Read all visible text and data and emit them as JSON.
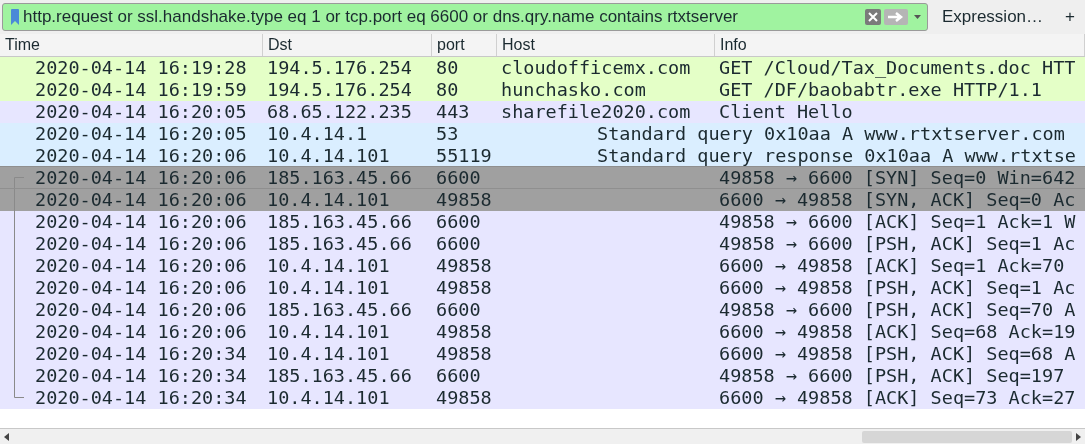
{
  "filter": {
    "value": "http.request or ssl.handshake.type eq 1 or tcp.port eq 6600 or dns.qry.name contains rtxtserver",
    "valid": true,
    "expression_button": "Expression…",
    "add_button": "+"
  },
  "table": {
    "columns": [
      "Time",
      "Dst",
      "port",
      "Host",
      "Info"
    ],
    "rows": [
      {
        "kind": "plain",
        "color": "#e4ffc7",
        "selected": false,
        "time": "2020-04-14 16:19:28",
        "dst": "194.5.176.254",
        "port": "80",
        "host": "cloudofficemx.com",
        "info": "GET /Cloud/Tax_Documents.doc HTT"
      },
      {
        "kind": "plain",
        "color": "#e4ffc7",
        "selected": false,
        "time": "2020-04-14 16:19:59",
        "dst": "194.5.176.254",
        "port": "80",
        "host": "hunchasko.com",
        "info": "GET /DF/baobabtr.exe HTTP/1.1"
      },
      {
        "kind": "plain",
        "color": "#e7e6ff",
        "selected": false,
        "time": "2020-04-14 16:20:05",
        "dst": "68.65.122.235",
        "port": "443",
        "host": "sharefile2020.com",
        "info": "Client Hello"
      },
      {
        "kind": "dns",
        "color": "#daeeff",
        "selected": false,
        "time": "2020-04-14 16:20:05",
        "dst": "10.4.14.1",
        "port": "53",
        "info": "Standard query 0x10aa A www.rtxtserver.com"
      },
      {
        "kind": "dns",
        "color": "#daeeff",
        "selected": false,
        "time": "2020-04-14 16:20:06",
        "dst": "10.4.14.101",
        "port": "55119",
        "info": "Standard query response 0x10aa A www.rtxtse"
      },
      {
        "kind": "conv-first",
        "color": "#a0a0a0",
        "selected": true,
        "time": "2020-04-14 16:20:06",
        "dst": "185.163.45.66",
        "port": "6600",
        "info": "49858 → 6600 [SYN] Seq=0 Win=642"
      },
      {
        "kind": "conv-mid",
        "color": "#a0a0a0",
        "selected": true,
        "time": "2020-04-14 16:20:06",
        "dst": "10.4.14.101",
        "port": "49858",
        "info": "6600 → 49858 [SYN, ACK] Seq=0 Ac"
      },
      {
        "kind": "conv-mid",
        "color": "#e7e6ff",
        "selected": false,
        "time": "2020-04-14 16:20:06",
        "dst": "185.163.45.66",
        "port": "6600",
        "info": "49858 → 6600 [ACK] Seq=1 Ack=1 W"
      },
      {
        "kind": "conv-mid",
        "color": "#e7e6ff",
        "selected": false,
        "time": "2020-04-14 16:20:06",
        "dst": "185.163.45.66",
        "port": "6600",
        "info": "49858 → 6600 [PSH, ACK] Seq=1 Ac"
      },
      {
        "kind": "conv-mid",
        "color": "#e7e6ff",
        "selected": false,
        "time": "2020-04-14 16:20:06",
        "dst": "10.4.14.101",
        "port": "49858",
        "info": "6600 → 49858 [ACK] Seq=1 Ack=70"
      },
      {
        "kind": "conv-mid",
        "color": "#e7e6ff",
        "selected": false,
        "time": "2020-04-14 16:20:06",
        "dst": "10.4.14.101",
        "port": "49858",
        "info": "6600 → 49858 [PSH, ACK] Seq=1 Ac"
      },
      {
        "kind": "conv-mid",
        "color": "#e7e6ff",
        "selected": false,
        "time": "2020-04-14 16:20:06",
        "dst": "185.163.45.66",
        "port": "6600",
        "info": "49858 → 6600 [PSH, ACK] Seq=70 A"
      },
      {
        "kind": "conv-mid",
        "color": "#e7e6ff",
        "selected": false,
        "time": "2020-04-14 16:20:06",
        "dst": "10.4.14.101",
        "port": "49858",
        "info": "6600 → 49858 [ACK] Seq=68 Ack=19"
      },
      {
        "kind": "conv-mid",
        "color": "#e7e6ff",
        "selected": false,
        "time": "2020-04-14 16:20:34",
        "dst": "10.4.14.101",
        "port": "49858",
        "info": "6600 → 49858 [PSH, ACK] Seq=68 A"
      },
      {
        "kind": "conv-mid",
        "color": "#e7e6ff",
        "selected": false,
        "time": "2020-04-14 16:20:34",
        "dst": "185.163.45.66",
        "port": "6600",
        "info": "49858 → 6600 [PSH, ACK] Seq=197"
      },
      {
        "kind": "conv-last",
        "color": "#e7e6ff",
        "selected": false,
        "time": "2020-04-14 16:20:34",
        "dst": "10.4.14.101",
        "port": "49858",
        "info": "6600 → 49858 [ACK] Seq=73 Ack=27"
      }
    ]
  }
}
